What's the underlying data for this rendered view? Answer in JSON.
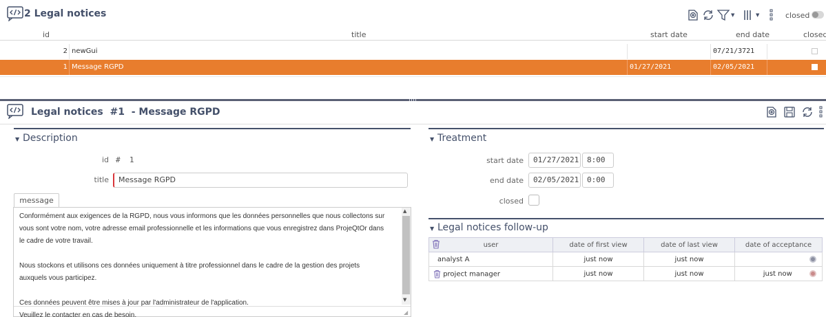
{
  "list": {
    "title": "2 Legal notices",
    "closed_label": "closed",
    "columns": {
      "id": "id",
      "title": "title",
      "start_date": "start date",
      "end_date": "end date",
      "closed": "closed"
    },
    "rows": [
      {
        "id": "2",
        "title": "newGui",
        "start_date": "",
        "end_date": "07/21/3721",
        "closed": false
      },
      {
        "id": "1",
        "title": "Message RGPD",
        "start_date": "01/27/2021",
        "end_date": "02/05/2021",
        "closed": false
      }
    ],
    "selected_color": "#e87d2d"
  },
  "detail": {
    "title": "Legal notices  #1  - Message RGPD",
    "description": {
      "section_title": "Description",
      "id_label": "id",
      "id_value": "#  1",
      "title_label": "title",
      "title_value": "Message RGPD",
      "message_tab": "message",
      "message_text": "Conformément aux exigences de la RGPD, nous vous informons que les données personnelles que nous collectons sur\nvous sont votre nom, votre adresse email professionnelle et les informations que vous enregistrez dans ProjeQtOr dans\nle cadre de votre travail.\n\nNous stockons et utilisons ces données uniquement à titre professionnel dans le cadre de la gestion des projets\nauxquels vous participez.\n\nCes données peuvent être mises à jour par l'administrateur de l'application.\nVeuillez le contacter en cas de besoin."
    },
    "treatment": {
      "section_title": "Treatment",
      "start_date_label": "start date",
      "start_date": "01/27/2021",
      "start_time": "8:00",
      "end_date_label": "end date",
      "end_date": "02/05/2021",
      "end_time": "0:00",
      "closed_label": "closed"
    },
    "followup": {
      "section_title": "Legal notices follow-up",
      "headers": {
        "user": "user",
        "first_view": "date of first view",
        "last_view": "date of last view",
        "acceptance": "date of acceptance"
      },
      "rows": [
        {
          "user": "analyst A",
          "first_view": "just now",
          "last_view": "just now",
          "acceptance": "",
          "status_color": "#8a8ea0"
        },
        {
          "user": "project manager",
          "first_view": "just now",
          "last_view": "just now",
          "acceptance": "just now",
          "status_color": "#c98a8a"
        }
      ]
    }
  },
  "colors": {
    "accent": "#44506a",
    "selected": "#e87d2d",
    "required": "#d9353a"
  },
  "icons": [
    "code-icon",
    "new-item-icon",
    "refresh-icon",
    "filter-icon",
    "columns-icon",
    "more-menu-icon",
    "save-icon",
    "trash-icon",
    "status-dot-icon"
  ]
}
